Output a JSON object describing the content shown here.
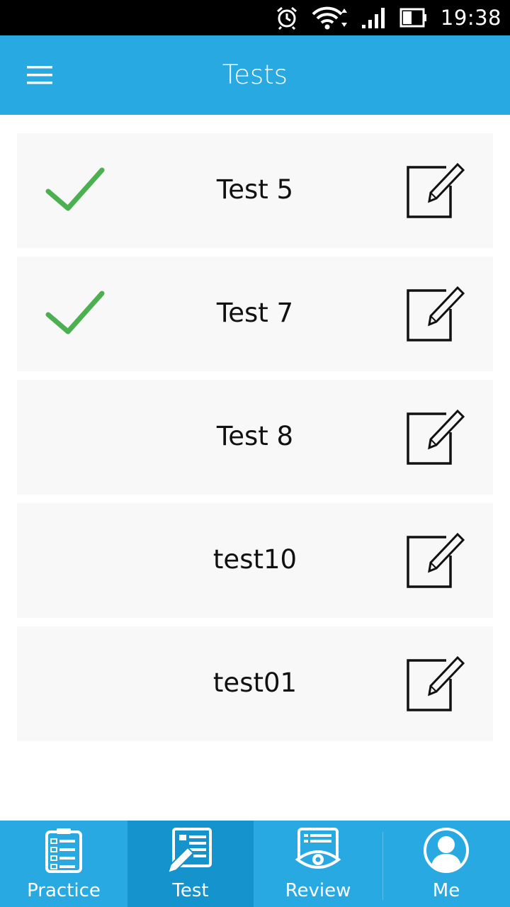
{
  "status_bar": {
    "time": "19:38",
    "icons": [
      "alarm-icon",
      "wifi-icon",
      "signal-icon",
      "battery-icon"
    ]
  },
  "app_bar": {
    "title": "Tests",
    "menu_icon": "hamburger-menu-icon"
  },
  "tests": [
    {
      "name": "Test 5",
      "completed": true
    },
    {
      "name": "Test 7",
      "completed": true
    },
    {
      "name": "Test 8",
      "completed": false
    },
    {
      "name": "test10",
      "completed": false
    },
    {
      "name": "test01",
      "completed": false
    }
  ],
  "bottom_nav": {
    "items": [
      {
        "label": "Practice",
        "icon": "checklist-icon",
        "active": false
      },
      {
        "label": "Test",
        "icon": "test-pen-icon",
        "active": true
      },
      {
        "label": "Review",
        "icon": "eye-icon",
        "active": false
      },
      {
        "label": "Me",
        "icon": "profile-icon",
        "active": false
      }
    ]
  },
  "colors": {
    "primary": "#29a9e1",
    "active_tab": "#1593cc",
    "check": "#4caf50",
    "row_bg": "#f8f8f8"
  }
}
